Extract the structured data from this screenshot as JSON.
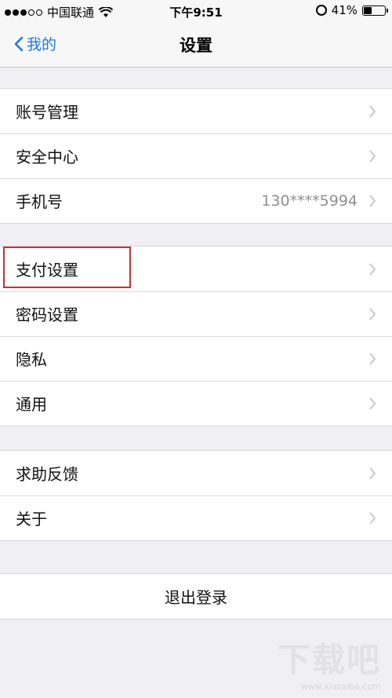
{
  "status_bar": {
    "carrier": "中国联通",
    "time": "下午9:51",
    "battery": "41%",
    "battery_level": 0.41
  },
  "nav": {
    "back_label": "我的",
    "title": "设置"
  },
  "groups": [
    {
      "rows": [
        {
          "label": "账号管理"
        },
        {
          "label": "安全中心"
        },
        {
          "label": "手机号",
          "value": "130****5994"
        }
      ]
    },
    {
      "rows": [
        {
          "label": "支付设置",
          "highlighted": true
        },
        {
          "label": "密码设置"
        },
        {
          "label": "隐私"
        },
        {
          "label": "通用"
        }
      ]
    },
    {
      "rows": [
        {
          "label": "求助反馈"
        },
        {
          "label": "关于"
        }
      ]
    }
  ],
  "logout_label": "退出登录",
  "watermark": {
    "text": "下载吧",
    "url": "www.xiazaiba.com"
  },
  "colors": {
    "accent": "#1a78f0",
    "highlight_box": "#e0272b",
    "background": "#efeff4"
  }
}
